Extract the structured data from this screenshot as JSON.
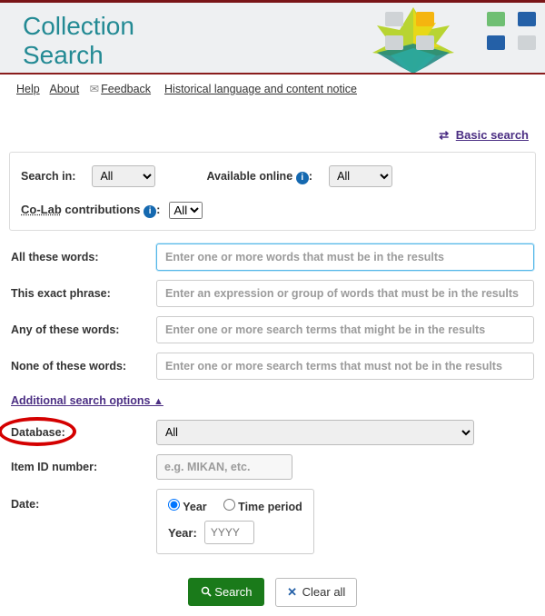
{
  "header": {
    "title_line1": "Collection",
    "title_line2": "Search"
  },
  "utility_links": {
    "help": "Help",
    "about": "About",
    "feedback": "Feedback",
    "historical_notice": "Historical language and content notice"
  },
  "mode_switch": {
    "basic_search": "Basic search"
  },
  "filters": {
    "search_in_label": "Search in:",
    "search_in_value": "All",
    "available_online_label": "Available online",
    "available_online_value": "All",
    "colab_label": "Co-Lab",
    "contributions_label": "contributions",
    "colab_value": "All"
  },
  "keywords": {
    "all_label": "All these words:",
    "all_placeholder": "Enter one or more words that must be in the results",
    "exact_label": "This exact phrase:",
    "exact_placeholder": "Enter an expression or group of words that must be in the results",
    "any_label": "Any of these words:",
    "any_placeholder": "Enter one or more search terms that might be in the results",
    "none_label": "None of these words:",
    "none_placeholder": "Enter one or more search terms that must not be in the results"
  },
  "additional_link": "Additional search options",
  "advanced": {
    "database_label": "Database:",
    "database_value": "All",
    "item_id_label": "Item ID number:",
    "item_id_placeholder": "e.g. MIKAN, etc.",
    "date_label": "Date:",
    "radio_year": "Year",
    "radio_period": "Time period",
    "year_label": "Year:",
    "year_placeholder": "YYYY"
  },
  "buttons": {
    "search": "Search",
    "clear": "Clear all"
  }
}
